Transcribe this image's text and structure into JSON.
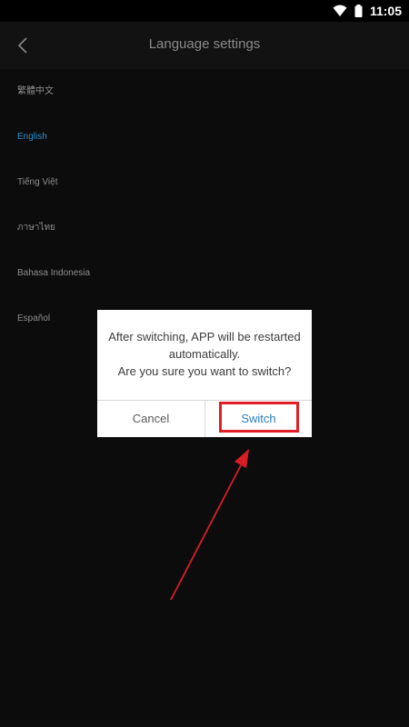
{
  "status_bar": {
    "time": "11:05",
    "wifi_icon": "wifi-icon",
    "battery_icon": "battery-icon"
  },
  "header": {
    "back_icon": "chevron-left-icon",
    "title": "Language settings"
  },
  "languages": [
    {
      "label": "繁體中文",
      "selected": false
    },
    {
      "label": "English",
      "selected": true
    },
    {
      "label": "Tiếng Việt",
      "selected": false
    },
    {
      "label": "ภาษาไทย",
      "selected": false
    },
    {
      "label": "Bahasa Indonesia",
      "selected": false
    },
    {
      "label": "Español",
      "selected": false
    }
  ],
  "dialog": {
    "message_line1": "After switching, APP will be restarted",
    "message_line2": "automatically.",
    "message_line3": "Are you sure you want to switch?",
    "cancel_label": "Cancel",
    "switch_label": "Switch"
  },
  "colors": {
    "background": "#0c0c0d",
    "selected_language": "#2f8fc9",
    "switch_button": "#2a7fc0",
    "highlight": "#e01e25"
  }
}
